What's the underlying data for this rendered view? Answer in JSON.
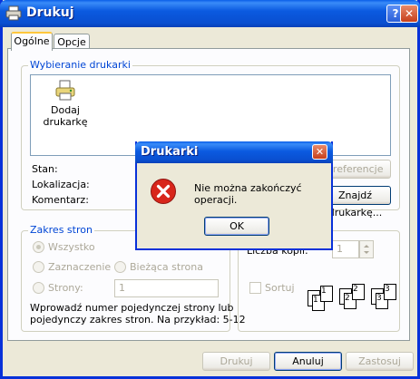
{
  "window": {
    "title": "Drukuj",
    "help_glyph": "?",
    "close_glyph": "✕"
  },
  "tabs": [
    {
      "label": "Ogólne"
    },
    {
      "label": "Opcje"
    }
  ],
  "printer_select": {
    "group_label": "Wybieranie drukarki",
    "add_printer_label_line1": "Dodaj",
    "add_printer_label_line2": "drukarkę",
    "status_label": "Stan:",
    "location_label": "Lokalizacja:",
    "comment_label": "Komentarz:",
    "preferences_button": "Preferencje",
    "find_printer_button": "Znajdź drukarkę..."
  },
  "page_range": {
    "group_label": "Zakres stron",
    "all_label": "Wszystko",
    "selection_label": "Zaznaczenie",
    "current_page_label": "Bieżąca strona",
    "pages_label": "Strony:",
    "pages_value": "1",
    "hint_line1": "Wprowadź numer pojedynczej strony lub",
    "hint_line2": "pojedynczy zakres stron. Na przykład: 5-12"
  },
  "copies": {
    "count_label": "Liczba kopii:",
    "count_value": "1",
    "collate_label": "Sortuj",
    "page_numbers": [
      "1",
      "2",
      "3",
      "1",
      "2",
      "3"
    ]
  },
  "footer": {
    "print_button": "Drukuj",
    "cancel_button": "Anuluj",
    "apply_button": "Zastosuj"
  },
  "modal": {
    "title": "Drukarki",
    "close_glyph": "✕",
    "message": "Nie można zakończyć operacji.",
    "ok_button": "OK"
  },
  "colors": {
    "titlebar": "#0a5ee8",
    "group_label": "#0046d5",
    "error_red": "#d8261b",
    "window_bg": "#ece9d8"
  }
}
